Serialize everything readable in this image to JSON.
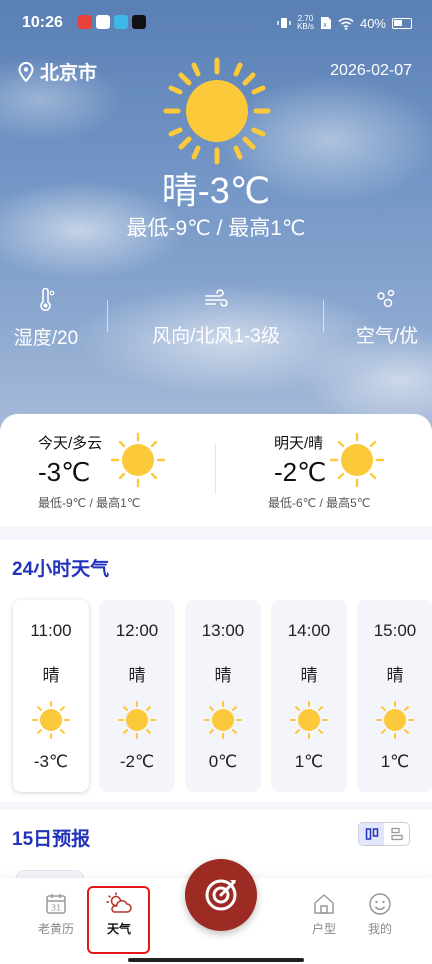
{
  "status_bar": {
    "time": "10:26",
    "net_speed_value": "2.70",
    "net_speed_unit": "KB/s",
    "battery": "40%"
  },
  "header": {
    "city": "北京市",
    "date": "2026-02-07",
    "current": "晴-3℃",
    "low_high": "最低-9℃  /  最高1℃",
    "details": [
      {
        "label": "湿度/20",
        "icon": "thermometer-icon"
      },
      {
        "label": "风向/北风1-3级",
        "icon": "wind-icon"
      },
      {
        "label": "空气/优",
        "icon": "air-icon"
      }
    ]
  },
  "today": {
    "title": "今天/多云",
    "temp": "-3℃",
    "range": "最低-9℃ / 最高1℃"
  },
  "tomorrow": {
    "title": "明天/晴",
    "temp": "-2℃",
    "range": "最低-6℃ / 最高5℃"
  },
  "hourly": {
    "title": "24小时天气",
    "items": [
      {
        "time": "11:00",
        "cond": "晴",
        "temp": "-3℃"
      },
      {
        "time": "12:00",
        "cond": "晴",
        "temp": "-2℃"
      },
      {
        "time": "13:00",
        "cond": "晴",
        "temp": "0℃"
      },
      {
        "time": "14:00",
        "cond": "晴",
        "temp": "1℃"
      },
      {
        "time": "15:00",
        "cond": "晴",
        "temp": "1℃"
      }
    ]
  },
  "forecast": {
    "title": "15日预报"
  },
  "nav": {
    "calendar": "老黄历",
    "weather": "天气",
    "house": "户型",
    "mine": "我的"
  },
  "colors": {
    "accent_blue": "#2233bb",
    "sun": "#fcc93a",
    "fab": "#9b2b23",
    "highlight": "#e01818"
  }
}
